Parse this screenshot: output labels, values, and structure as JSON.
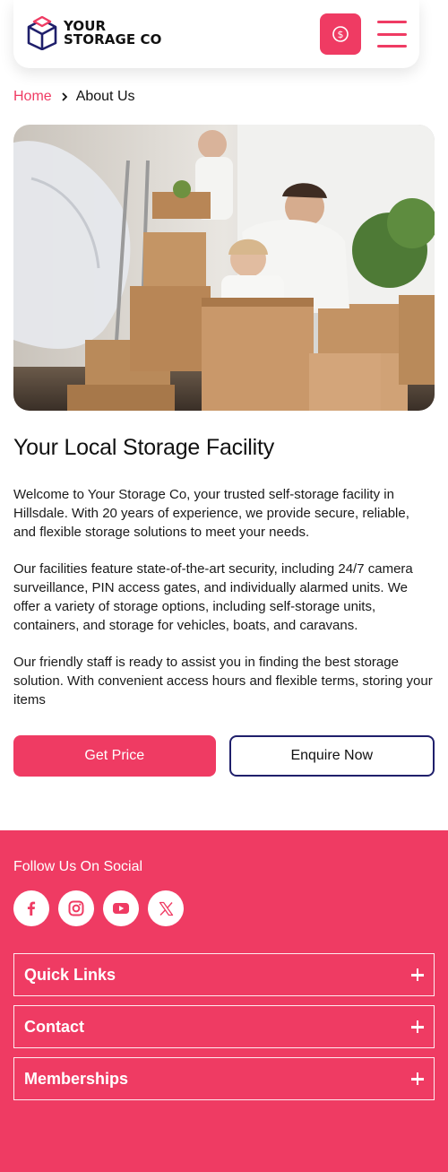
{
  "header": {
    "logo_line1": "YOUR",
    "logo_line2": "STORAGE CO",
    "price_icon": "dollar-circle-icon",
    "menu_icon": "hamburger-icon"
  },
  "breadcrumb": {
    "home": "Home",
    "current": "About Us"
  },
  "main": {
    "title": "Your Local Storage Facility",
    "paragraphs": [
      "Welcome to Your Storage Co, your trusted self-storage facility in Hillsdale. With 20 years of experience, we provide secure, reliable, and flexible storage solutions to meet your needs.",
      "Our facilities feature state-of-the-art security, including 24/7 camera surveillance, PIN access gates, and individually alarmed units. We offer a variety of storage options, including self-storage units, containers, and storage for vehicles, boats, and caravans.",
      "Our friendly staff is ready to assist you in finding the best storage solution. With convenient access hours and flexible terms, storing your items"
    ],
    "get_price": "Get Price",
    "enquire_now": "Enquire Now"
  },
  "footer": {
    "follow_label": "Follow Us On Social",
    "socials": [
      "facebook-icon",
      "instagram-icon",
      "youtube-icon",
      "x-icon"
    ],
    "accordions": [
      "Quick Links",
      "Contact",
      "Memberships"
    ]
  },
  "colors": {
    "accent": "#ef3b63",
    "navy": "#1f1f6b"
  }
}
